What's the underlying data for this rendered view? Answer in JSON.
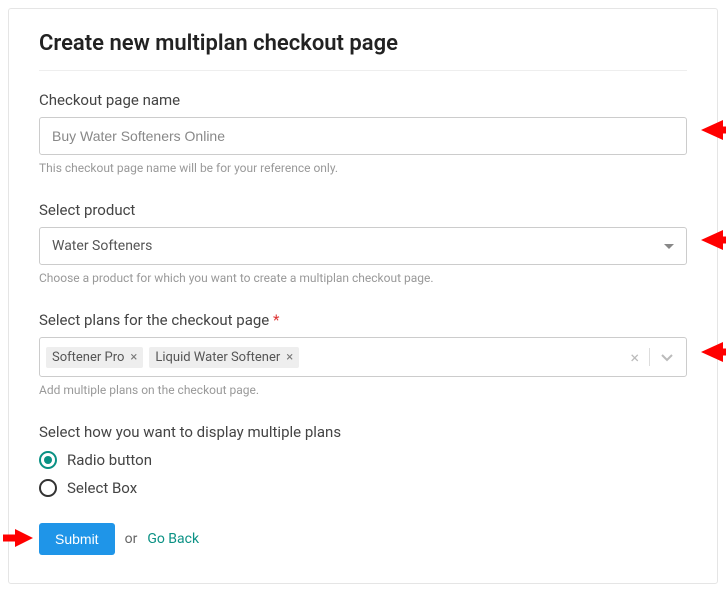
{
  "title": "Create new multiplan checkout page",
  "fields": {
    "name": {
      "label": "Checkout page name",
      "value": "Buy Water Softeners Online",
      "help": "This checkout page name will be for your reference only."
    },
    "product": {
      "label": "Select product",
      "value": "Water Softeners",
      "help": "Choose a product for which you want to create a multiplan checkout page."
    },
    "plans": {
      "label": "Select plans for the checkout page",
      "required": "*",
      "chips": [
        "Softener Pro",
        "Liquid Water Softener"
      ],
      "help": "Add multiple plans on the checkout page."
    },
    "display": {
      "label": "Select how you want to display multiple plans",
      "options": [
        "Radio button",
        "Select Box"
      ],
      "selected": "Radio button"
    }
  },
  "actions": {
    "submit": "Submit",
    "or": "or",
    "back": "Go Back"
  }
}
